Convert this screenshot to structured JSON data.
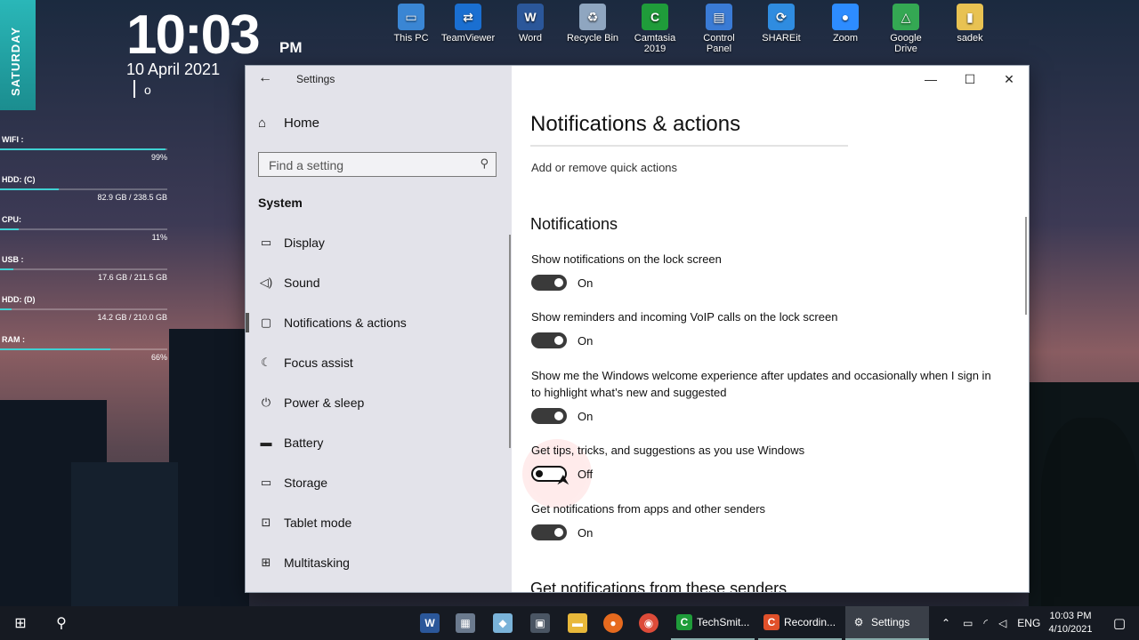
{
  "widget": {
    "day": "SATURDAY",
    "time": "10:03",
    "ampm": "PM",
    "date": "10 April 2021",
    "sub": "o"
  },
  "stats": [
    {
      "label": "WIFI :",
      "value": "99%",
      "percent": 99
    },
    {
      "label": "HDD: (C)",
      "value": "82.9 GB / 238.5 GB",
      "percent": 35
    },
    {
      "label": "CPU:",
      "value": "11%",
      "percent": 11
    },
    {
      "label": "USB :",
      "value": "17.6 GB / 211.5 GB",
      "percent": 8
    },
    {
      "label": "HDD: (D)",
      "value": "14.2 GB / 210.0 GB",
      "percent": 7
    },
    {
      "label": "RAM :",
      "value": "66%",
      "percent": 66
    }
  ],
  "desktop_icons": [
    {
      "label": "This PC",
      "icon": "computer-icon",
      "color": "#3a86d4"
    },
    {
      "label": "TeamViewer",
      "icon": "teamviewer-icon",
      "color": "#1a6fd1"
    },
    {
      "label": "Word",
      "icon": "word-icon",
      "color": "#2b579a"
    },
    {
      "label": "Recycle Bin",
      "icon": "recycle-bin-icon",
      "color": "#8fa6c0"
    },
    {
      "label": "Camtasia 2019",
      "icon": "camtasia-icon",
      "color": "#1f9c3a"
    },
    {
      "label": "Control Panel",
      "icon": "control-panel-icon",
      "color": "#3a7bd5"
    },
    {
      "label": "SHAREit",
      "icon": "shareit-icon",
      "color": "#2f8ce0"
    },
    {
      "label": "Zoom",
      "icon": "zoom-icon",
      "color": "#2d8cff"
    },
    {
      "label": "Google Drive",
      "icon": "google-drive-icon",
      "color": "#34a853"
    },
    {
      "label": "sadek",
      "icon": "folder-icon",
      "color": "#e8c252"
    }
  ],
  "settings": {
    "window_title": "Settings",
    "home": "Home",
    "search_placeholder": "Find a setting",
    "section": "System",
    "nav": [
      {
        "label": "Display",
        "icon": "display-icon"
      },
      {
        "label": "Sound",
        "icon": "sound-icon"
      },
      {
        "label": "Notifications & actions",
        "icon": "notifications-icon",
        "active": true
      },
      {
        "label": "Focus assist",
        "icon": "moon-icon"
      },
      {
        "label": "Power & sleep",
        "icon": "power-icon"
      },
      {
        "label": "Battery",
        "icon": "battery-icon"
      },
      {
        "label": "Storage",
        "icon": "storage-icon"
      },
      {
        "label": "Tablet mode",
        "icon": "tablet-mode-icon"
      },
      {
        "label": "Multitasking",
        "icon": "multitasking-icon"
      }
    ],
    "page_title": "Notifications & actions",
    "quick_actions_link": "Add or remove quick actions",
    "notifications_heading": "Notifications",
    "options": [
      {
        "desc": "Show notifications on the lock screen",
        "state": "On",
        "on": true
      },
      {
        "desc": "Show reminders and incoming VoIP calls on the lock screen",
        "state": "On",
        "on": true
      },
      {
        "desc": "Show me the Windows welcome experience after updates and occasionally when I sign in to highlight what’s new and suggested",
        "state": "On",
        "on": true
      },
      {
        "desc": "Get tips, tricks, and suggestions as you use Windows",
        "state": "Off",
        "on": false
      },
      {
        "desc": "Get notifications from apps and other senders",
        "state": "On",
        "on": true
      }
    ],
    "senders_heading": "Get notifications from these senders"
  },
  "taskbar": {
    "apps": [
      {
        "label": "TechSmit...",
        "icon": "camtasia-icon",
        "color": "#1f9c3a"
      },
      {
        "label": "Recordin...",
        "icon": "recorder-icon",
        "color": "#e0502a"
      },
      {
        "label": "Settings",
        "icon": "gear-icon",
        "color": "#3a3f48"
      }
    ],
    "lang": "ENG",
    "time": "10:03 PM",
    "date": "4/10/2021"
  }
}
